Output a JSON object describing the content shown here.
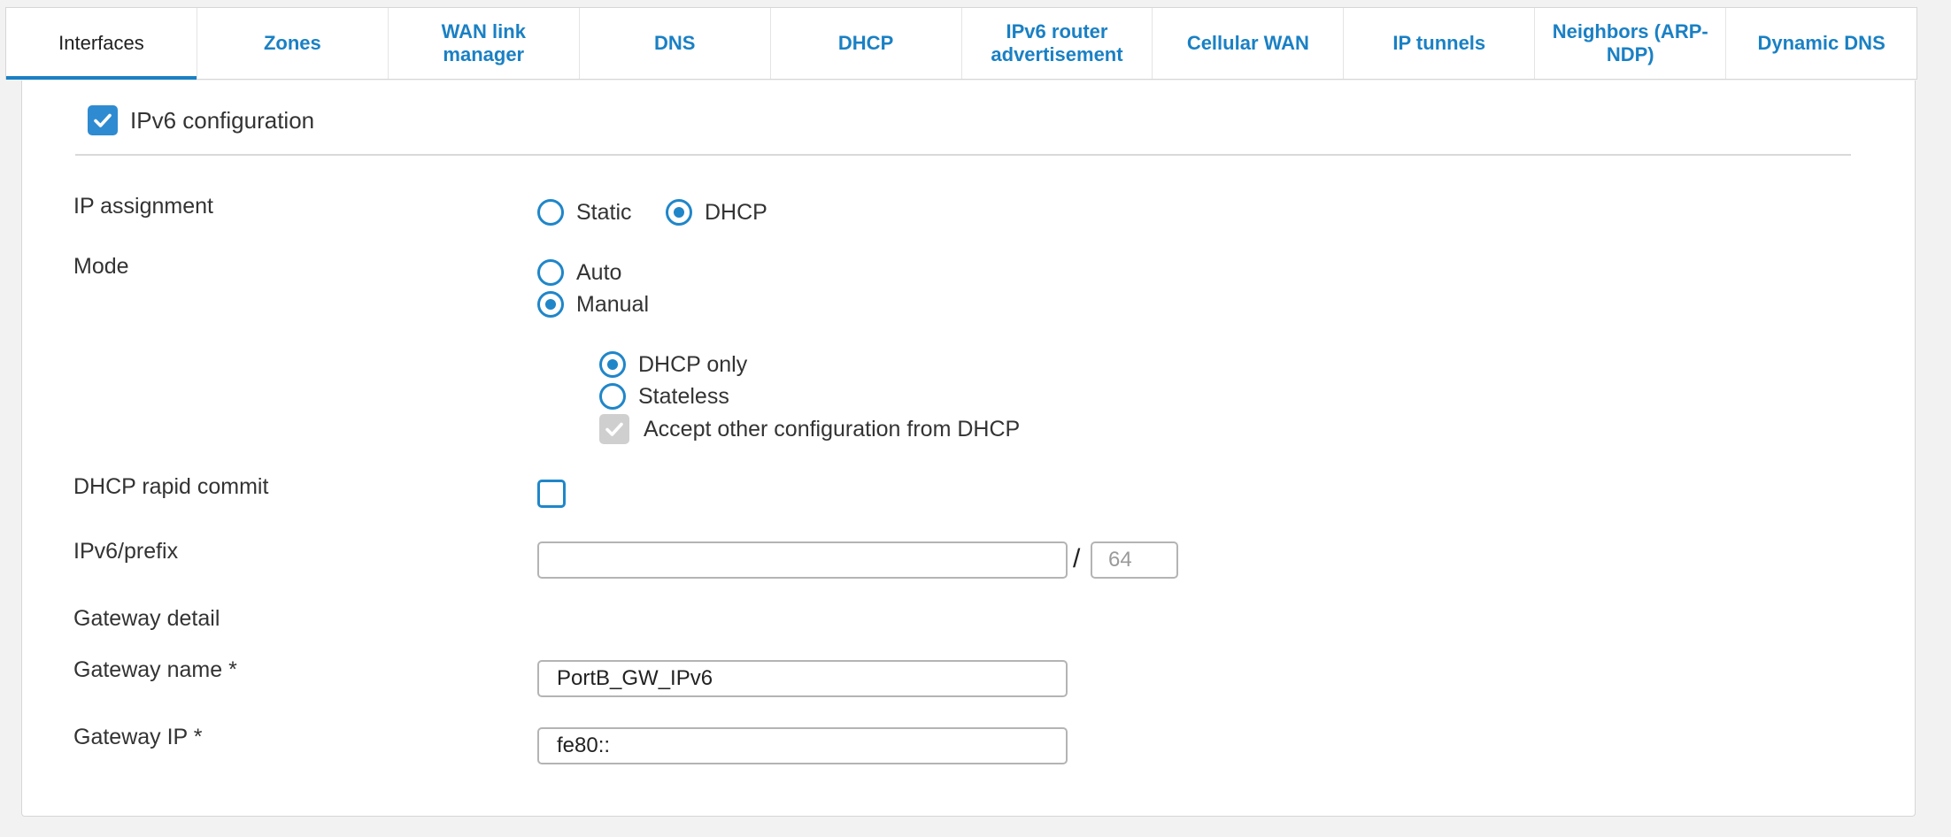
{
  "tabs": [
    {
      "label": "Interfaces",
      "active": true
    },
    {
      "label": "Zones"
    },
    {
      "label": "WAN link manager"
    },
    {
      "label": "DNS"
    },
    {
      "label": "DHCP"
    },
    {
      "label": "IPv6 router advertisement"
    },
    {
      "label": "Cellular WAN"
    },
    {
      "label": "IP tunnels"
    },
    {
      "label": "Neighbors (ARP-NDP)"
    },
    {
      "label": "Dynamic DNS"
    }
  ],
  "section": {
    "title": "IPv6 configuration",
    "checked": true
  },
  "ip_assignment": {
    "label": "IP assignment",
    "options": [
      "Static",
      "DHCP"
    ],
    "selected": "DHCP"
  },
  "mode": {
    "label": "Mode",
    "options": [
      "Auto",
      "Manual"
    ],
    "selected": "Manual",
    "sub_options": [
      "DHCP only",
      "Stateless"
    ],
    "sub_selected": "DHCP only",
    "accept_other_label": "Accept other configuration from DHCP",
    "accept_other_checked": true,
    "accept_other_disabled": true
  },
  "rapid_commit": {
    "label": "DHCP rapid commit",
    "checked": false
  },
  "ipv6_prefix": {
    "label": "IPv6/prefix",
    "value": "",
    "separator": "/",
    "prefix_placeholder": "64"
  },
  "gateway_detail": {
    "label": "Gateway detail"
  },
  "gateway_name": {
    "label": "Gateway name *",
    "value": "PortB_GW_IPv6"
  },
  "gateway_ip": {
    "label": "Gateway IP *",
    "value": "fe80::"
  },
  "colors": {
    "accent": "#1a80c4",
    "disabled": "#cfcfcf",
    "border": "#b4b4b4"
  }
}
